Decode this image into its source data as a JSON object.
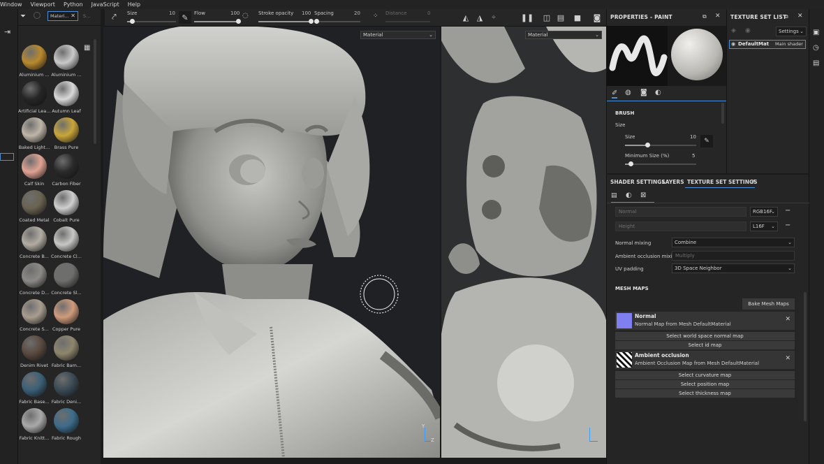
{
  "menu": [
    "Window",
    "Viewport",
    "Python",
    "JavaScript",
    "Help"
  ],
  "toolbar": {
    "size_label": "Size",
    "size_value": "10",
    "flow_label": "Flow",
    "flow_value": "100",
    "stroke_label": "Stroke opacity",
    "stroke_value": "100",
    "spacing_label": "Spacing",
    "spacing_value": "20",
    "distance_label": "Distance",
    "distance_value": "0",
    "size_level": 0.12,
    "flow_level": 1.0,
    "stroke_level": 1.0,
    "spacing_level": 0.05
  },
  "shelf": {
    "tab_label": "Materi...",
    "search_label": "S...",
    "materials": [
      {
        "label": "Aluminium ...",
        "color": "#b8892d"
      },
      {
        "label": "Aluminium ...",
        "color": "#c9c9c9"
      },
      {
        "label": "Artificial Lea...",
        "color": "#262626"
      },
      {
        "label": "Autumn Leaf",
        "color": "#d9d9d9"
      },
      {
        "label": "Baked Light...",
        "color": "#bfb5a8"
      },
      {
        "label": "Brass Pure",
        "color": "#c9a63a"
      },
      {
        "label": "Calf Skin",
        "color": "#e0a293"
      },
      {
        "label": "Carbon Fiber",
        "color": "#2a2a2a"
      },
      {
        "label": "Coated Metal",
        "color": "#6a6352"
      },
      {
        "label": "Cobalt Pure",
        "color": "#cfcfcf"
      },
      {
        "label": "Concrete B...",
        "color": "#b2aca3"
      },
      {
        "label": "Concrete Cl...",
        "color": "#c7c7c4"
      },
      {
        "label": "Concrete D...",
        "color": "#8c8a86"
      },
      {
        "label": "Concrete Sl...",
        "color": "#6e6e6c"
      },
      {
        "label": "Concrete S...",
        "color": "#a89d8f"
      },
      {
        "label": "Copper Pure",
        "color": "#d09b7c"
      },
      {
        "label": "Denim Rivet",
        "color": "#5a4a3f"
      },
      {
        "label": "Fabric Bam...",
        "color": "#8e866d"
      },
      {
        "label": "Fabric Base...",
        "color": "#3b6077"
      },
      {
        "label": "Fabric Deni...",
        "color": "#3a4a55"
      },
      {
        "label": "Fabric Knitt...",
        "color": "#a9a9a9"
      },
      {
        "label": "Fabric Rough",
        "color": "#3d6c8a"
      }
    ]
  },
  "viewport": {
    "left_select": "Material",
    "right_select": "Material",
    "axis_y": "Y",
    "axis_z": "Z"
  },
  "properties": {
    "title": "PROPERTIES - PAINT",
    "brush_header": "BRUSH",
    "size_group": "Size",
    "size_label": "Size",
    "size_value": "10",
    "min_size_label": "Minimum Size (%)",
    "min_size_value": "5"
  },
  "texture_set_list": {
    "title": "TEXTURE SET LIST",
    "settings_label": "Settings",
    "item_name": "DefaultMat",
    "item_shader": "Main shader"
  },
  "tss": {
    "tabs": [
      "SHADER SETTINGS",
      "LAYERS",
      "TEXTURE SET SETTINGS"
    ],
    "normal_placeholder": "Normal",
    "normal_format": "RGB16F",
    "height_placeholder": "Height",
    "height_format": "L16F",
    "normal_mixing_label": "Normal mixing",
    "normal_mixing_value": "Combine",
    "ao_mixing_label": "Ambient occlusion mixing",
    "ao_mixing_value": "Multiply",
    "uv_padding_label": "UV padding",
    "uv_padding_value": "3D Space Neighbor",
    "mesh_maps_header": "MESH MAPS",
    "bake_button": "Bake Mesh Maps",
    "normal_card_title": "Normal",
    "normal_card_desc": "Normal Map from Mesh DefaultMaterial",
    "btn_world_normal": "Select world space normal map",
    "btn_id": "Select id map",
    "ao_card_title": "Ambient occlusion",
    "ao_card_desc": "Ambient Occlusion Map from Mesh DefaultMaterial",
    "btn_curvature": "Select curvature map",
    "btn_position": "Select position map",
    "btn_thickness": "Select thickness map"
  }
}
